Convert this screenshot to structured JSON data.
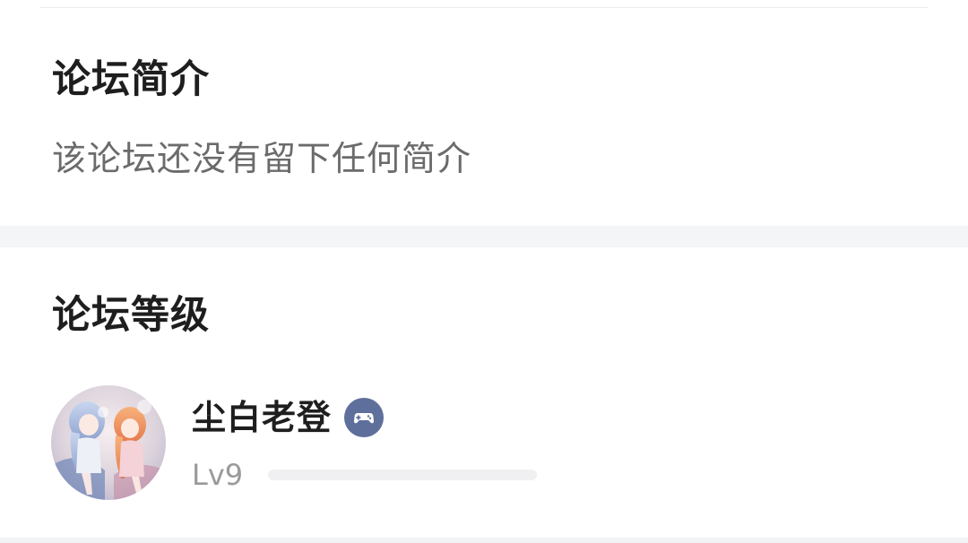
{
  "intro": {
    "title": "论坛简介",
    "text": "该论坛还没有留下任何简介"
  },
  "level": {
    "title": "论坛等级",
    "user": {
      "name": "尘白老登",
      "badge_icon": "gamepad-icon",
      "level_label": "Lv9",
      "progress": 0.0
    }
  },
  "colors": {
    "title_text": "#1e1e1e",
    "body_text": "#6b6b6b",
    "muted_text": "#9a9a9a",
    "badge_bg": "#5f6f9c",
    "section_gap": "#f4f5f7"
  }
}
